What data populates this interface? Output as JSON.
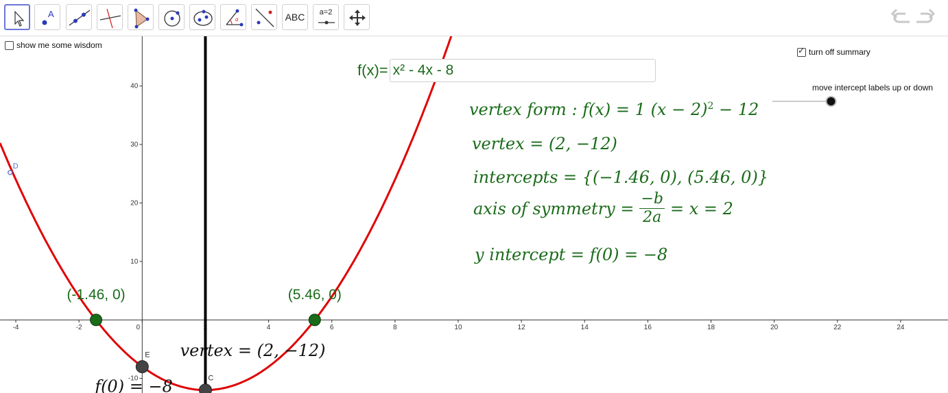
{
  "toolbar": {
    "tools": [
      {
        "name": "move-tool",
        "label": ""
      },
      {
        "name": "point-tool",
        "label": ""
      },
      {
        "name": "line-tool",
        "label": ""
      },
      {
        "name": "perpendicular-line-tool",
        "label": ""
      },
      {
        "name": "polygon-tool",
        "label": ""
      },
      {
        "name": "circle-tool",
        "label": ""
      },
      {
        "name": "ellipse-tool",
        "label": ""
      },
      {
        "name": "angle-tool",
        "label": ""
      },
      {
        "name": "reflect-tool",
        "label": ""
      },
      {
        "name": "text-tool",
        "label": "ABC"
      },
      {
        "name": "slider-tool",
        "label": "a=2"
      },
      {
        "name": "move-graphics-view-tool",
        "label": ""
      }
    ],
    "undo_icon": "undo-icon",
    "redo_icon": "redo-icon"
  },
  "checkboxes": {
    "wisdom": {
      "label": "show me some wisdom",
      "checked": false
    },
    "summary": {
      "label": "turn off summary",
      "checked": true
    }
  },
  "input_bar": {
    "label": "f(x)=",
    "value": "x² - 4x - 8"
  },
  "slider": {
    "label": "move intercept labels up or down",
    "value_fraction": 0.95
  },
  "summary": {
    "vertex_form_lhs": "vertex form : f(x) = 1  (x − 2)",
    "vertex_form_exp": "2",
    "vertex_form_rhs": " − 12",
    "vertex": "vertex = (2, −12)",
    "intercepts": "intercepts = {(−1.46, 0), (5.46, 0)}",
    "axis_lhs": "axis of symmetry =",
    "axis_num": "−b",
    "axis_den": "2a",
    "axis_rhs": "= x = 2",
    "y_intercept": "y intercept = f(0) = −8"
  },
  "colors": {
    "curve": "#e00000",
    "summary_text": "#1a6b1a",
    "intercept_point": "#1a6b1a",
    "point_dark": "#444444",
    "point_D": "#4f6fd8"
  },
  "chart_data": {
    "type": "line",
    "function": "x^2 - 4x - 8",
    "xlim": [
      -4.5,
      25.5
    ],
    "ylim": [
      -12.5,
      48.5
    ],
    "x_ticks": [
      -4,
      -2,
      0,
      2,
      4,
      6,
      8,
      10,
      12,
      14,
      16,
      18,
      20,
      22,
      24
    ],
    "y_ticks": [
      -10,
      10,
      20,
      30,
      40
    ],
    "axis_of_symmetry_x": 2,
    "points": [
      {
        "name": "x-intercept-left",
        "x": -1.46,
        "y": 0,
        "label": "(-1.46, 0)"
      },
      {
        "name": "x-intercept-right",
        "x": 5.46,
        "y": 0,
        "label": "(5.46, 0)"
      },
      {
        "name": "point-E",
        "x": 0,
        "y": -8,
        "label": "E"
      },
      {
        "name": "point-C",
        "x": 2,
        "y": -12,
        "label": "C"
      },
      {
        "name": "point-D",
        "x": -4.18,
        "y": 25.2,
        "label": "D"
      }
    ],
    "annotations": [
      {
        "name": "vertex-annotation",
        "text": "vertex = (2, −12)",
        "x": 1.2,
        "y": -6.2
      },
      {
        "name": "f0-annotation",
        "text": "f(0) = −8",
        "x": -1.5,
        "y": -12.3
      }
    ]
  }
}
